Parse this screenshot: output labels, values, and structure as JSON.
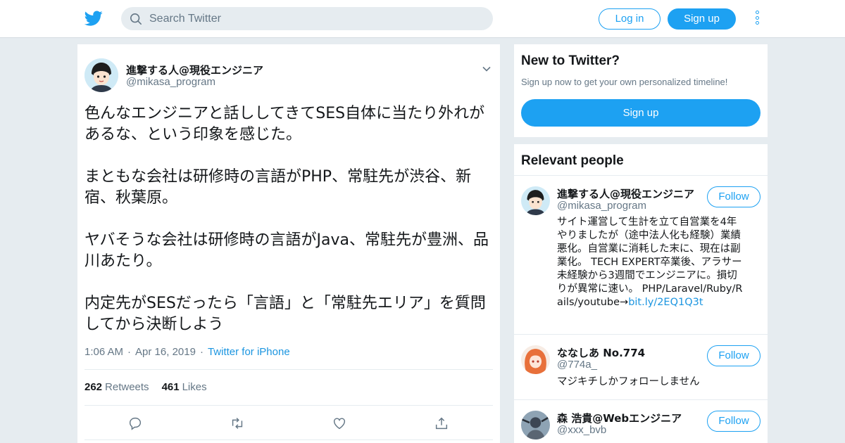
{
  "header": {
    "search_placeholder": "Search Twitter",
    "login_label": "Log in",
    "signup_label": "Sign up",
    "accent": "#1da1f2"
  },
  "tweet": {
    "author_name": "進撃する人@現役エンジニア",
    "author_handle": "@mikasa_program",
    "text": "色んなエンジニアと話ししてきてSES自体に当たり外れがあるな、という印象を感じた。\n\nまともな会社は研修時の言語がPHP、常駐先が渋谷、新宿、秋葉原。\n\nヤバそうな会社は研修時の言語がJava、常駐先が豊洲、品川あたり。\n\n内定先がSESだったら「言語」と「常駐先エリア」を質問してから決断しよう",
    "time": "1:06 AM",
    "date": "Apr 16, 2019",
    "source": "Twitter for iPhone",
    "retweets_count": "262",
    "retweets_label": "Retweets",
    "likes_count": "461",
    "likes_label": "Likes",
    "actions": [
      "reply-icon",
      "retweet-icon",
      "like-icon",
      "share-icon"
    ]
  },
  "new_to_twitter": {
    "title": "New to Twitter?",
    "subtitle": "Sign up now to get your own personalized timeline!",
    "button_label": "Sign up"
  },
  "relevant_people": {
    "title": "Relevant people",
    "follow_label": "Follow",
    "people": [
      {
        "name": "進撃する人@現役エンジニア",
        "handle": "@mikasa_program",
        "bio": "サイト運営して生計を立て自営業を4年やりましたが（途中法人化も経験）業績悪化。自営業に消耗した末に、現在は副業化。 TECH EXPERT卒業後、アラサー未経験から3週間でエンジニアに。損切りが異常に速い。 PHP/Laravel/Ruby/Rails/youtube→",
        "bio_link": "bit.ly/2EQ1Q3t"
      },
      {
        "name": "ななしあ No.774",
        "handle": "@774a_",
        "bio": "マジキチしかフォローしません"
      },
      {
        "name": "森 浩貴@Webエンジニア",
        "handle": "@xxx_bvb"
      }
    ]
  }
}
